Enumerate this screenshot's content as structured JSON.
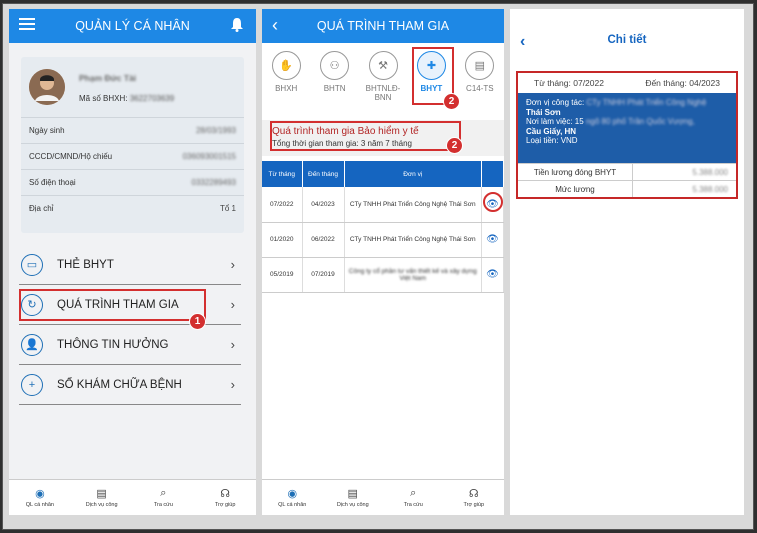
{
  "panel1": {
    "title": "QUẢN LÝ CÁ NHÂN",
    "profile": {
      "name": "Phạm Đức Tài",
      "bhxh_label": "Mã số BHXH:",
      "bhxh_value": "3622703639",
      "rows": [
        {
          "label": "Ngày sinh",
          "value": "28/03/1993"
        },
        {
          "label": "CCCD/CMND/Hộ chiếu",
          "value": "036093001515"
        },
        {
          "label": "Số điện thoại",
          "value": "0332289493"
        },
        {
          "label": "Địa chỉ",
          "value": "Tổ 1"
        }
      ]
    },
    "menu": [
      {
        "label": "THẺ BHYT"
      },
      {
        "label": "QUÁ TRÌNH THAM GIA"
      },
      {
        "label": "THÔNG TIN HƯỞNG"
      },
      {
        "label": "SỔ KHÁM CHỮA BỆNH"
      }
    ],
    "badge": "1"
  },
  "panel2": {
    "title": "QUÁ TRÌNH THAM GIA",
    "tabs": [
      {
        "label": "BHXH"
      },
      {
        "label": "BHTN"
      },
      {
        "label": "BHTNLĐ-BNN"
      },
      {
        "label": "BHYT"
      },
      {
        "label": "C14-TS"
      }
    ],
    "badge": "2",
    "info_title": "Quá trình tham gia Bảo hiểm y tế",
    "info_total": "Tổng thời gian tham gia: 3 năm 7 tháng",
    "table_headers": {
      "from": "Từ tháng",
      "to": "Đến tháng",
      "unit": "Đơn vị"
    },
    "rows": [
      {
        "from": "07/2022",
        "to": "04/2023",
        "unit": "CTy TNHH Phát Triển Công Nghệ Thái Sơn"
      },
      {
        "from": "01/2020",
        "to": "06/2022",
        "unit": "CTy TNHH Phát Triển Công Nghệ Thái Sơn"
      },
      {
        "from": "05/2019",
        "to": "07/2019",
        "unit": "Công ty cổ phần tư vấn thiết kế và xây dựng Việt Nam"
      }
    ]
  },
  "panel3": {
    "title": "Chi tiết",
    "from": "Từ tháng: 07/2022",
    "to": "Đến tháng: 04/2023",
    "work_unit_label": "Đơn vị công tác:",
    "work_unit_blur": "CTy TNHH Phát Triển Công Nghệ",
    "work_unit_value": "Thái Sơn",
    "workplace_label": "Nơi làm việc: 15",
    "workplace_blur": "ngõ 80 phố Trần Quốc Vượng,",
    "workplace_value": "Cầu Giấy, HN",
    "currency": "Loại tiền: VND",
    "salary_rows": [
      {
        "label": "Tiền lương đóng BHYT",
        "value": "5.388.000"
      },
      {
        "label": "Mức lương",
        "value": "5.388.000"
      }
    ]
  },
  "bottom_nav": [
    "QL cá nhân",
    "Dịch vụ công",
    "Tra cứu",
    "Trợ giúp"
  ],
  "colors": {
    "primary": "#1e88e5",
    "highlight": "#d32f2f",
    "table_header": "#1565c0"
  }
}
